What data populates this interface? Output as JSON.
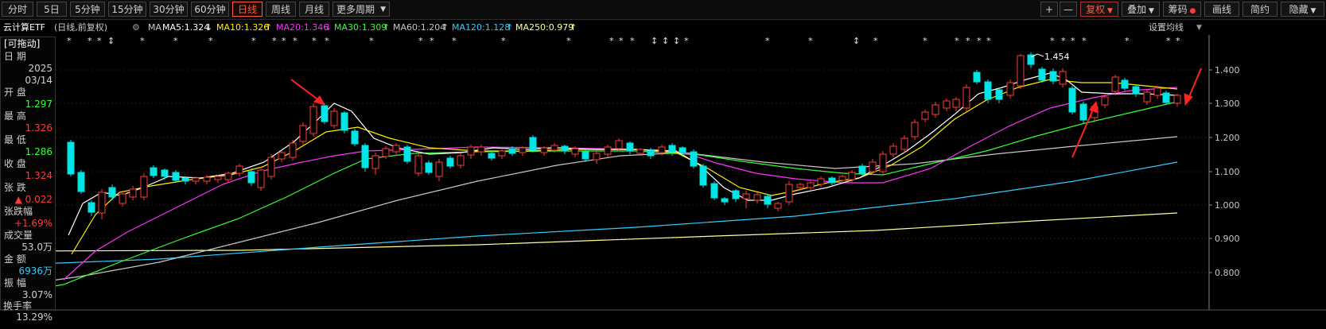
{
  "toolbar": {
    "left_tabs": [
      "分时",
      "5日",
      "5分钟",
      "15分钟",
      "30分钟",
      "60分钟",
      "日线",
      "周线",
      "月线",
      "更多周期"
    ],
    "active_tab": "日线",
    "right_buttons": [
      "+",
      "—",
      "复权",
      "叠加",
      "筹码",
      "画线",
      "简约",
      "隐藏"
    ]
  },
  "legend": {
    "name": "云计算ETF",
    "mode": "(日线,前复权)",
    "ma_label": "MA",
    "ma": [
      {
        "text": "MA5:1.324",
        "arrow": "↓",
        "color": "#ffffff"
      },
      {
        "text": "MA10:1.326",
        "arrow": "↑",
        "color": "#ffee00"
      },
      {
        "text": "MA20:1.346",
        "arrow": "↓",
        "color": "#ff33ff"
      },
      {
        "text": "MA30:1.309",
        "arrow": "↑",
        "color": "#33ff33"
      },
      {
        "text": "MA60:1.204",
        "arrow": "↑",
        "color": "#c8c8c8"
      },
      {
        "text": "MA120:1.128",
        "arrow": "↑",
        "color": "#33ccff"
      },
      {
        "text": "MA250:0.979",
        "arrow": "↑",
        "color": "#ffff99"
      }
    ],
    "settings": "设置均线"
  },
  "info_panel": {
    "drag": "[可拖动]",
    "date_label": "日 期",
    "date_year": "2025",
    "date_md": "03/14",
    "open_label": "开 盘",
    "open": "1.297",
    "high_label": "最 高",
    "high": "1.326",
    "low_label": "最 低",
    "low": "1.286",
    "close_label": "收 盘",
    "close": "1.324",
    "change_label": "张 跌",
    "change": "▲ 0.022",
    "pct_label": "张跌幅",
    "pct": "+1.69%",
    "vol_label": "成交量",
    "vol": "53.0万",
    "amt_label": "金 额",
    "amt": "6936万",
    "amp_label": "振 幅",
    "amp": "3.07%",
    "turn_label": "换手率",
    "turn": "13.29%"
  },
  "chart_data": {
    "type": "candlestick",
    "ylim": [
      0.745,
      1.535
    ],
    "yticks": [
      "1.400",
      "1.300",
      "1.200",
      "1.100",
      "1.000",
      "0.900",
      "0.800"
    ],
    "peak_label": "1.454",
    "up_color": "#ff3a3a",
    "down_color": "#00e5e5"
  }
}
